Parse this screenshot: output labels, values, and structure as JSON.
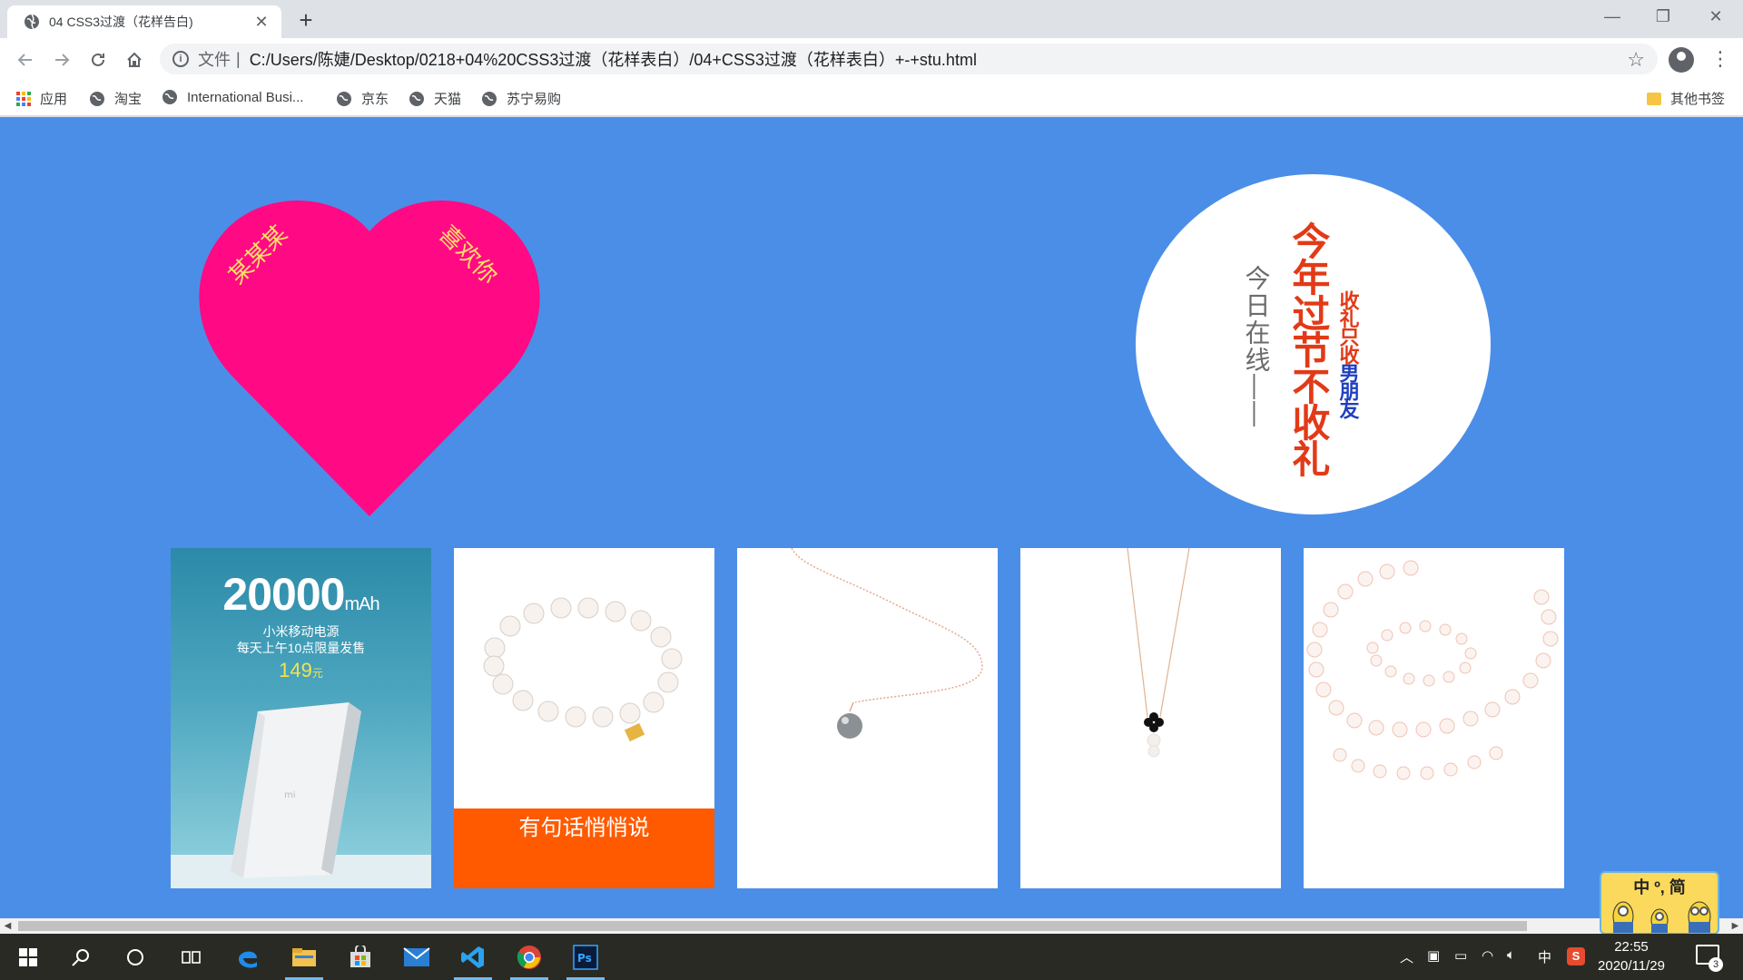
{
  "browser": {
    "tab_title": "04 CSS3过渡（花样告白)",
    "close_glyph": "✕",
    "new_tab_glyph": "+",
    "window_controls": [
      "—",
      "❐",
      "✕"
    ],
    "address": {
      "scheme_label": "文件",
      "separator": "|",
      "url": "C:/Users/陈婕/Desktop/0218+04%20CSS3过渡（花样表白）/04+CSS3过渡（花样表白）+-+stu.html"
    },
    "bookmarks": [
      {
        "label": "应用",
        "icon": "apps-grid-icon"
      },
      {
        "label": "淘宝",
        "icon": "globe-icon"
      },
      {
        "label": "International Busi...",
        "icon": "globe-icon"
      },
      {
        "label": "京东",
        "icon": "globe-icon"
      },
      {
        "label": "天猫",
        "icon": "globe-icon"
      },
      {
        "label": "苏宁易购",
        "icon": "globe-icon"
      }
    ],
    "other_bookmarks": "其他书签"
  },
  "page": {
    "background": "#4b8ee8",
    "heart": {
      "color": "#ff0a84",
      "left_text": "某某某",
      "right_text": "喜欢你",
      "text_color": "#ffe066"
    },
    "circle": {
      "col_gray": "今日在线——",
      "col_red": "今年过节不收礼",
      "col_small_red": "收礼只收",
      "col_small_blue": "男朋友"
    },
    "cards": [
      {
        "kind": "powerbank",
        "headline_number": "20000",
        "headline_unit": "mAh",
        "line1": "小米移动电源",
        "line2": "每天上午10点限量发售",
        "price": "149",
        "price_unit": "元",
        "logo": "mi"
      },
      {
        "kind": "bracelet",
        "caption": "有句话悄悄说"
      },
      {
        "kind": "pendant-gray"
      },
      {
        "kind": "pendant-clover"
      },
      {
        "kind": "pearl-set"
      }
    ]
  },
  "taskbar": {
    "ime_mode": "中",
    "clock_time": "22:55",
    "clock_date": "2020/11/29",
    "notification_count": "3",
    "ime_sticker": "中 º, 简 "
  }
}
